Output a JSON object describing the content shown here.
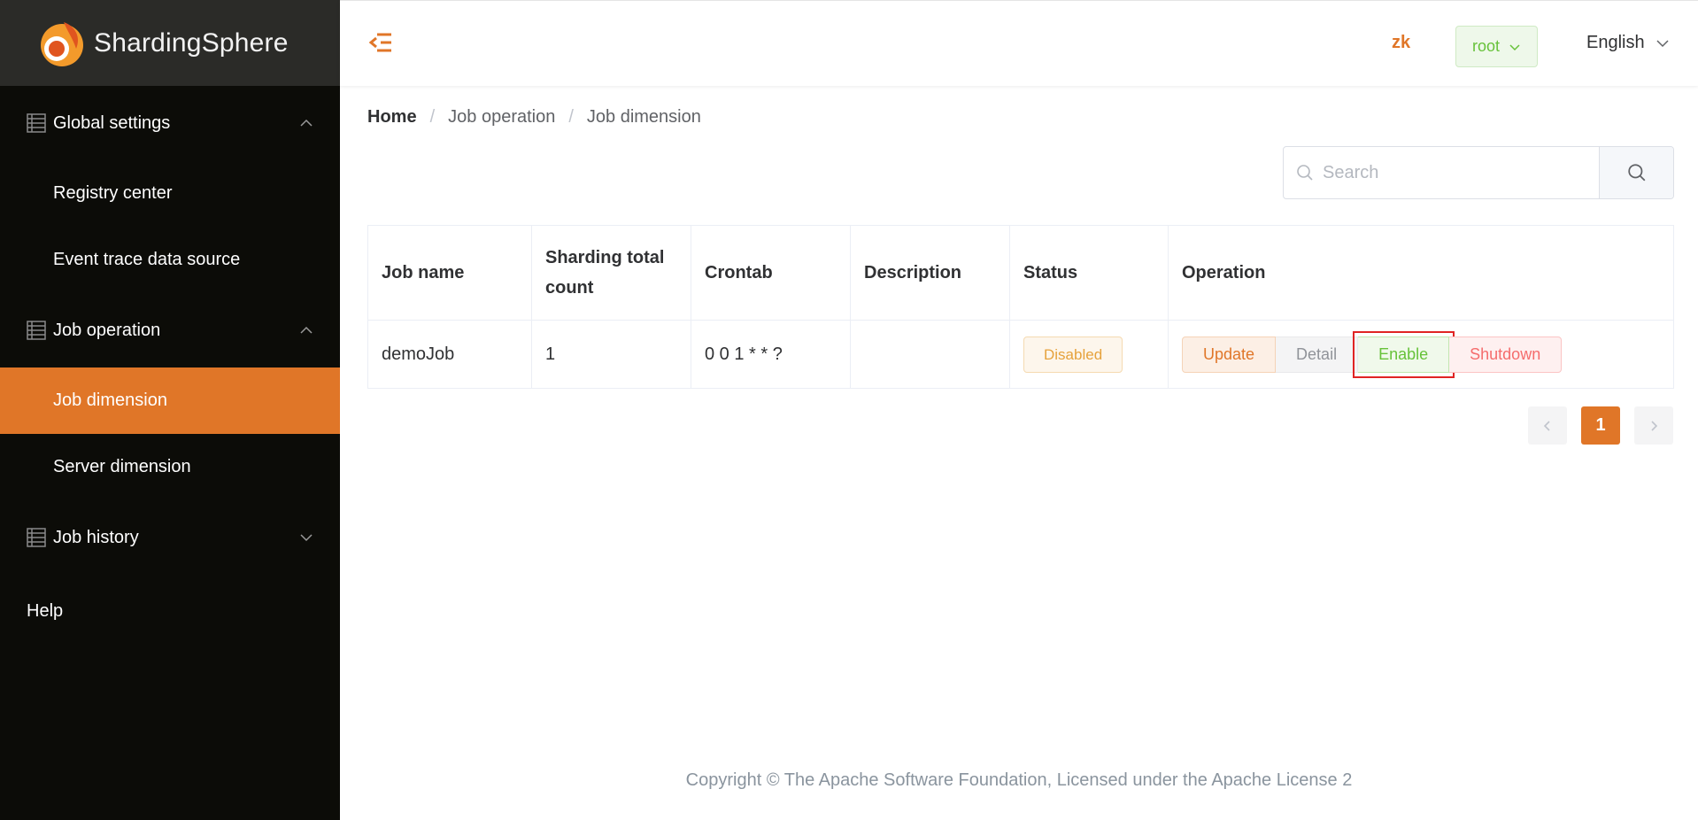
{
  "brand": {
    "name": "ShardingSphere",
    "logo_icon": "sharding-sphere-logo-icon",
    "accent": "#e07628"
  },
  "sidebar": {
    "groups": [
      {
        "label": "Global settings",
        "icon": "table-grid-icon",
        "expanded": true,
        "items": [
          {
            "label": "Registry center"
          },
          {
            "label": "Event trace data source"
          }
        ]
      },
      {
        "label": "Job operation",
        "icon": "table-grid-icon",
        "expanded": true,
        "items": [
          {
            "label": "Job dimension",
            "active": true
          },
          {
            "label": "Server dimension"
          }
        ]
      },
      {
        "label": "Job history",
        "icon": "table-grid-icon",
        "expanded": false,
        "items": []
      }
    ],
    "help_label": "Help",
    "bg_color": "#0c0c08",
    "active_color": "#e07628"
  },
  "header": {
    "registry_label": "zk",
    "user_label": "root",
    "language_label": "English"
  },
  "breadcrumb": [
    "Home",
    "Job operation",
    "Job dimension"
  ],
  "search": {
    "placeholder": "Search",
    "value": ""
  },
  "table": {
    "columns": [
      "Job name",
      "Sharding total count",
      "Crontab",
      "Description",
      "Status",
      "Operation"
    ],
    "rows": [
      {
        "job_name": "demoJob",
        "sharding_total_count": "1",
        "crontab": "0 0 1 * * ?",
        "description": "",
        "status": "Disabled",
        "operations": [
          "Update",
          "Detail",
          "Enable",
          "Shutdown"
        ]
      }
    ]
  },
  "pagination": {
    "current_page": "1"
  },
  "footer": {
    "text": "Copyright © The Apache Software Foundation, Licensed under the Apache License 2"
  }
}
